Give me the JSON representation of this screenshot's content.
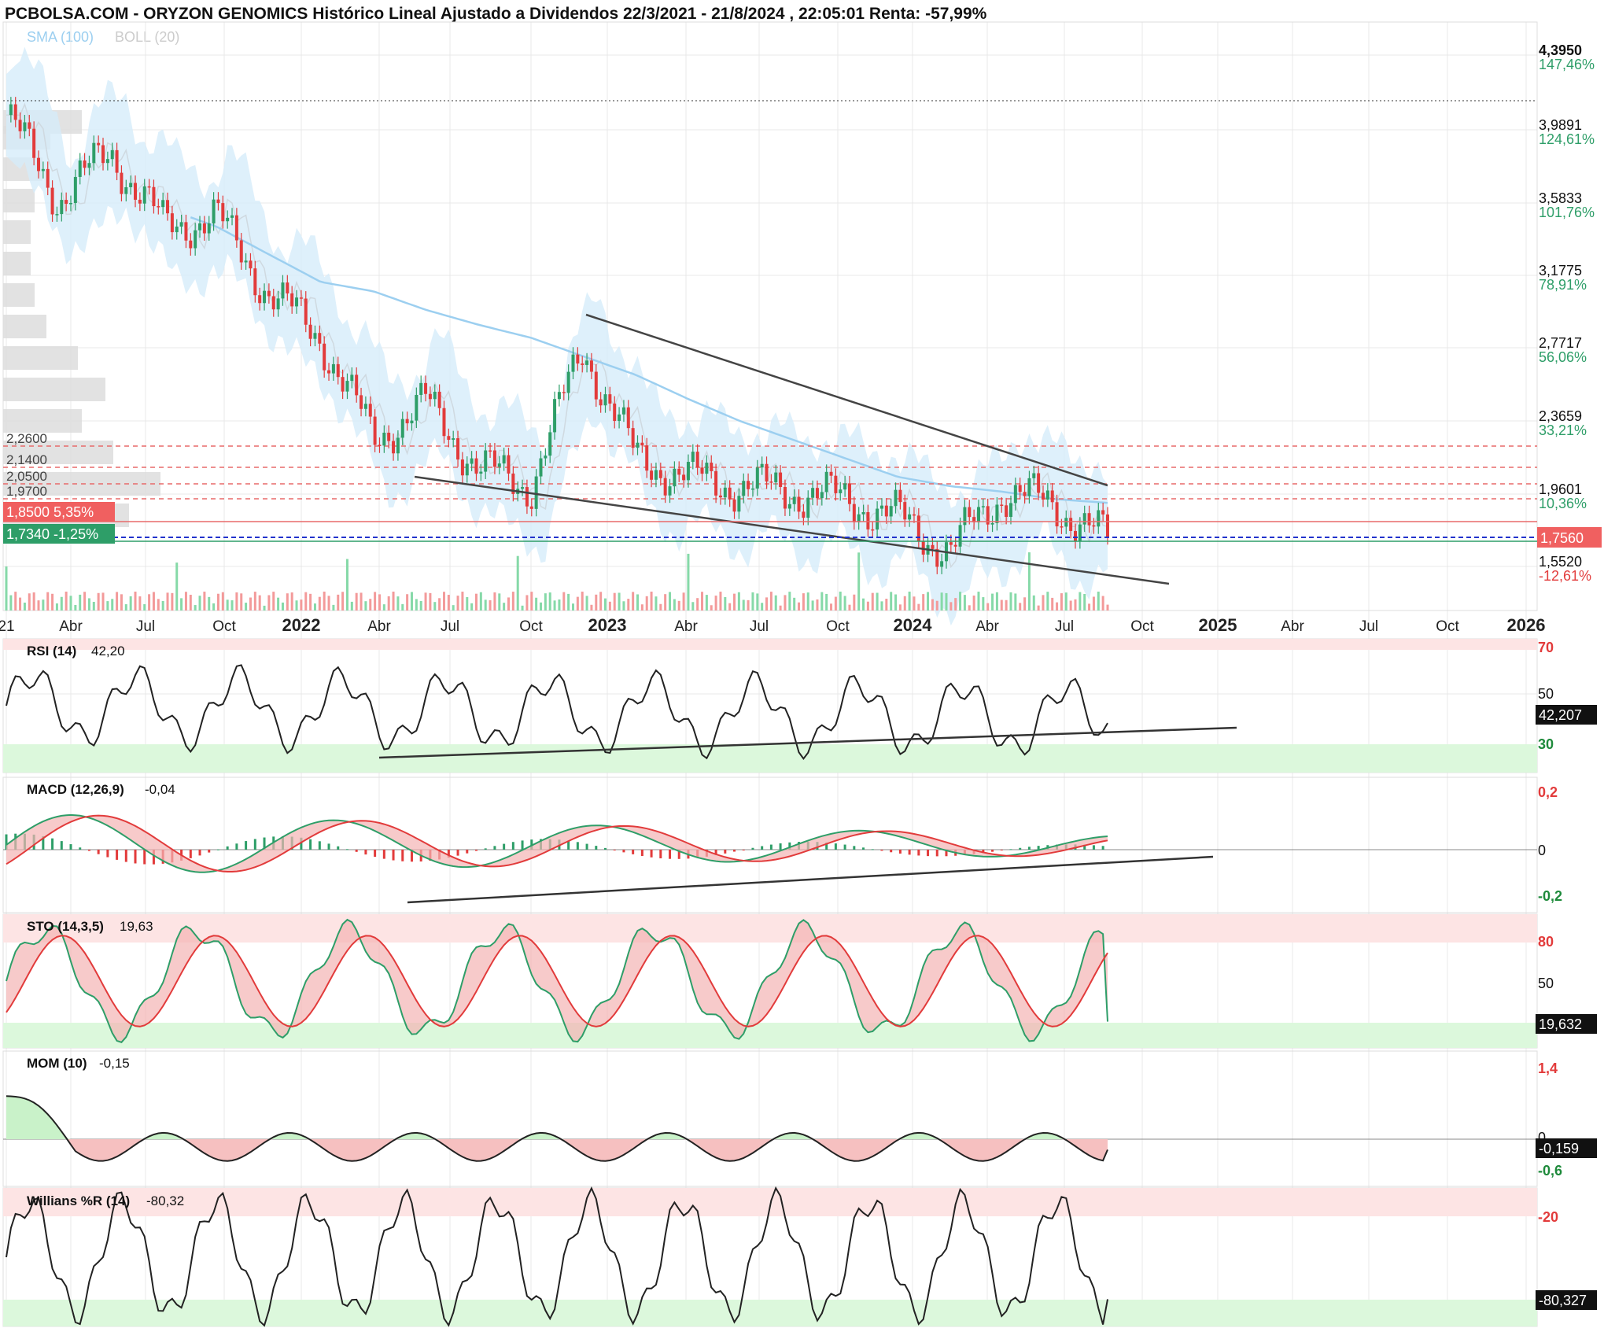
{
  "header": {
    "title": "PCBOLSA.COM - ORYZON GENOMICS Histórico Lineal Ajustado a Dividendos 22/3/2021 - 21/8/2024 , 22:05:01 Renta: -57,99%",
    "legend_sma": "SMA (100)",
    "legend_boll": "BOLL (20)"
  },
  "colors": {
    "up": "#2e9e68",
    "down": "#e23b3b",
    "boll_fill": "#d6ecfa",
    "sma": "#9ccff0",
    "level": "#e86a6a",
    "current_blue": "#2233cc"
  },
  "price_axis": [
    {
      "price": "4,3950",
      "pct": "147,46%"
    },
    {
      "price": "3,9891",
      "pct": "124,61%"
    },
    {
      "price": "3,5833",
      "pct": "101,76%"
    },
    {
      "price": "3,1775",
      "pct": "78,91%"
    },
    {
      "price": "2,7717",
      "pct": "56,06%"
    },
    {
      "price": "2,3659",
      "pct": "33,21%"
    },
    {
      "price": "1,9601",
      "pct": "10,36%"
    },
    {
      "price": "1,5520",
      "pct": "-12,61%"
    }
  ],
  "levels": [
    {
      "label": "2,2600",
      "value": 2.26
    },
    {
      "label": "2,1400",
      "value": 2.14
    },
    {
      "label": "2,0500",
      "value": 2.05
    },
    {
      "label": "1,9700",
      "value": 1.97
    }
  ],
  "tags": {
    "red_tag": "1,8500  5,35%",
    "green_tag": "1,7340  -1,25%",
    "last_price": "1,7560"
  },
  "x_axis": [
    "21",
    "Abr",
    "Jul",
    "Oct",
    "2022",
    "Abr",
    "Jul",
    "Oct",
    "2023",
    "Abr",
    "Jul",
    "Oct",
    "2024",
    "Abr",
    "Jul",
    "Oct",
    "2025",
    "Abr",
    "Jul",
    "Oct",
    "2026"
  ],
  "panes": {
    "rsi": {
      "title": "RSI (14)",
      "value": "42,20",
      "axis": [
        "70",
        "50",
        "30"
      ],
      "last": "42,207"
    },
    "macd": {
      "title": "MACD (12,26,9)",
      "value": "-0,04",
      "axis": [
        "0,2",
        "0",
        "-0,2"
      ]
    },
    "sto": {
      "title": "STO (14,3,5)",
      "value": "19,63",
      "axis": [
        "80",
        "50"
      ],
      "last": "19,632"
    },
    "mom": {
      "title": "MOM (10)",
      "value": "-0,15",
      "axis": [
        "1,4",
        "0",
        "-0,6"
      ],
      "last": "-0,159"
    },
    "wr": {
      "title": "Willians %R (14)",
      "value": "-80,32",
      "axis": [
        "-20"
      ],
      "last": "-80,327"
    }
  },
  "chart_data": {
    "type": "line",
    "title": "PCBOLSA.COM - ORYZON GENOMICS Histórico Lineal Ajustado a Dividendos 22/3/2021 - 21/8/2024 , 22:05:01 Renta: -57,99%",
    "ylim": [
      1.38,
      4.5
    ],
    "x_dates": [
      "2021-03",
      "2021-05",
      "2021-07",
      "2021-09",
      "2021-11",
      "2022-01",
      "2022-03",
      "2022-05",
      "2022-07",
      "2022-09",
      "2022-11",
      "2023-01",
      "2023-03",
      "2023-05",
      "2023-07",
      "2023-09",
      "2023-11",
      "2024-01",
      "2024-03",
      "2024-05",
      "2024-07",
      "2024-08"
    ],
    "close": [
      4.05,
      3.6,
      3.85,
      3.45,
      3.5,
      3.1,
      2.85,
      2.3,
      2.5,
      2.15,
      2.05,
      2.8,
      2.2,
      2.1,
      2.05,
      2.02,
      1.98,
      1.88,
      1.7,
      2.02,
      1.95,
      1.756
    ],
    "sma100": [
      4.05,
      3.8,
      3.7,
      3.55,
      3.45,
      3.3,
      3.15,
      3.1,
      3.0,
      2.92,
      2.85,
      2.75,
      2.65,
      2.52,
      2.4,
      2.3,
      2.2,
      2.1,
      2.05,
      2.02,
      1.98,
      1.96
    ],
    "rsi_last": 42.2,
    "macd_last": -0.04,
    "sto_last": 19.63,
    "mom_last": -0.15,
    "williams_last": -80.32
  }
}
